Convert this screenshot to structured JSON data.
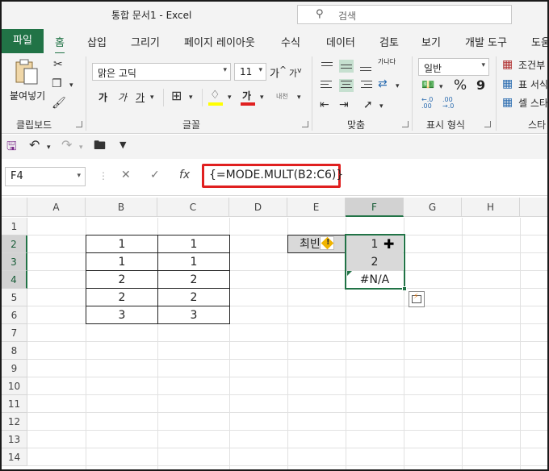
{
  "titlebar": {
    "title": "통합 문서1  -  Excel",
    "search_placeholder": "검색"
  },
  "tabs": [
    "파일",
    "홈",
    "삽입",
    "그리기",
    "페이지 레이아웃",
    "수식",
    "데이터",
    "검토",
    "보기",
    "개발 도구",
    "도움"
  ],
  "ribbon": {
    "clipboard": {
      "paste": "붙여넣기",
      "group": "클립보드"
    },
    "font": {
      "name": "맑은 고딕",
      "size": "11",
      "bold": "가",
      "italic": "가",
      "underline": "가",
      "group": "글꼴",
      "grow": "가",
      "shrink": "가",
      "phonetic": "내천"
    },
    "alignment": {
      "wrap": "가나다",
      "group": "맞춤"
    },
    "number": {
      "format": "일반",
      "percent": "%",
      "comma": "9",
      "dec_inc": "←.0 .00",
      "dec_dec": ".00 →.0",
      "group": "표시 형식"
    },
    "styles": {
      "cond": "조건부",
      "table": "표 서식",
      "cell": "셀 스타",
      "group": "스타"
    }
  },
  "formula_bar": {
    "name_box": "F4",
    "cancel": "✕",
    "enter": "✓",
    "fx": "fx",
    "formula": "{=MODE.MULT(B2:C6)}"
  },
  "columns": [
    "A",
    "B",
    "C",
    "D",
    "E",
    "F",
    "G",
    "H"
  ],
  "rows": [
    "1",
    "2",
    "3",
    "4",
    "5",
    "6",
    "7",
    "8",
    "9",
    "10",
    "11",
    "12",
    "13",
    "14"
  ],
  "cells": {
    "B": [
      "1",
      "1",
      "2",
      "2",
      "3"
    ],
    "C": [
      "1",
      "1",
      "2",
      "2",
      "3"
    ],
    "E2": "최빈",
    "F": [
      "1",
      "2",
      "#N/A"
    ]
  },
  "colors": {
    "accent": "#217346",
    "highlight": "#e02020",
    "selection": "#d9d9d9"
  }
}
